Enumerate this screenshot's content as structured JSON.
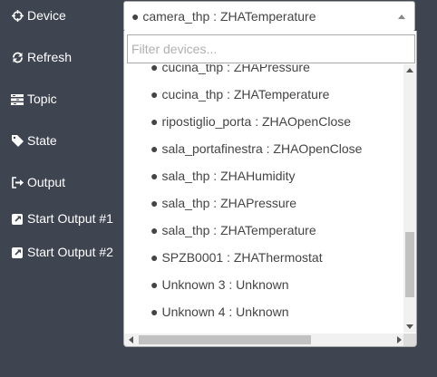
{
  "labels": {
    "device": "Device",
    "refresh": "Refresh",
    "topic": "Topic",
    "state": "State",
    "output": "Output",
    "start_output_1": "Start Output #1",
    "start_output_2": "Start Output #2"
  },
  "select": {
    "value": "● camera_thp : ZHATemperature"
  },
  "search": {
    "placeholder": "Filter devices..."
  },
  "options": [
    "cucina_thp : ZHAPressure",
    "cucina_thp : ZHATemperature",
    "ripostiglio_porta : ZHAOpenClose",
    "sala_portafinestra : ZHAOpenClose",
    "sala_thp : ZHAHumidity",
    "sala_thp : ZHAPressure",
    "sala_thp : ZHATemperature",
    "SPZB0001 : ZHAThermostat",
    "Unknown 3 : Unknown",
    "Unknown 4 : Unknown"
  ],
  "icons": {
    "device": "crosshairs-icon",
    "refresh": "refresh-icon",
    "topic": "tasks-icon",
    "state": "tag-icon",
    "output": "sign-out-icon",
    "start_output": "external-link-icon"
  },
  "scroll": {
    "vertical_fraction": 0.88,
    "horizontal_fraction": 0.0
  },
  "colors": {
    "background": "#3e4450",
    "dropdown_bg": "#ffffff",
    "option_text": "#444444",
    "label_text": "#ffffff"
  }
}
